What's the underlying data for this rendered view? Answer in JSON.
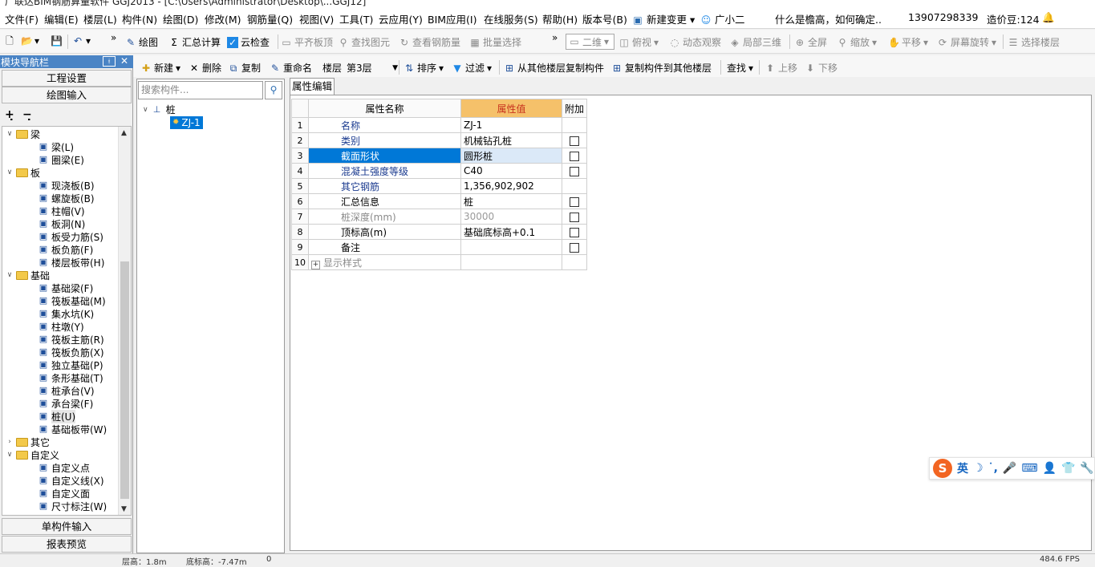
{
  "title_bar": "广联达BIM钢筋算量软件 GGJ2013 - [C:\\Users\\Administrator\\Desktop\\...GGJ12]",
  "menu": [
    "文件(F)",
    "编辑(E)",
    "楼层(L)",
    "构件(N)",
    "绘图(D)",
    "修改(M)",
    "钢筋量(Q)",
    "视图(V)",
    "工具(T)",
    "云应用(Y)",
    "BIM应用(I)",
    "在线服务(S)",
    "帮助(H)",
    "版本号(B)"
  ],
  "menu_extra": {
    "new_change": "新建变更",
    "assistant": "广小二",
    "question": "什么是檐高，如何确定..",
    "phone": "13907298339",
    "points": "造价豆:124"
  },
  "toolbar1": {
    "items": [
      "绘图",
      "汇总计算",
      "云检查",
      "平齐板顶",
      "查找图元",
      "查看钢筋量",
      "批量选择",
      "二维",
      "俯视",
      "动态观察",
      "局部三维",
      "全屏",
      "缩放",
      "平移",
      "屏幕旋转",
      "选择楼层"
    ],
    "more": "»"
  },
  "toolbar2": {
    "new": "新建",
    "delete": "删除",
    "copy": "复制",
    "rename": "重命名",
    "floor_label": "楼层",
    "floor_value": "第3层",
    "sort": "排序",
    "filter": "过滤",
    "copy_from": "从其他楼层复制构件",
    "copy_to": "复制构件到其他楼层",
    "find": "查找",
    "move_up": "上移",
    "move_down": "下移"
  },
  "nav": {
    "header": "模块导航栏",
    "project_settings": "工程设置",
    "drawing_input": "绘图输入",
    "single_input": "单构件输入",
    "report_preview": "报表预览",
    "tree": [
      {
        "type": "folder",
        "label": "梁",
        "level": 0,
        "open": true
      },
      {
        "type": "leaf",
        "label": "梁(L)",
        "icon": "beam-icon"
      },
      {
        "type": "leaf",
        "label": "圈梁(E)",
        "icon": "ring-beam-icon"
      },
      {
        "type": "folder",
        "label": "板",
        "level": 0,
        "open": true
      },
      {
        "type": "leaf",
        "label": "现浇板(B)",
        "icon": "slab-icon"
      },
      {
        "type": "leaf",
        "label": "螺旋板(B)",
        "icon": "spiral-slab-icon"
      },
      {
        "type": "leaf",
        "label": "柱帽(V)",
        "icon": "column-cap-icon"
      },
      {
        "type": "leaf",
        "label": "板洞(N)",
        "icon": "slab-hole-icon"
      },
      {
        "type": "leaf",
        "label": "板受力筋(S)",
        "icon": "slab-rebar-icon"
      },
      {
        "type": "leaf",
        "label": "板负筋(F)",
        "icon": "slab-neg-rebar-icon"
      },
      {
        "type": "leaf",
        "label": "楼层板带(H)",
        "icon": "slab-strip-icon"
      },
      {
        "type": "folder",
        "label": "基础",
        "level": 0,
        "open": true
      },
      {
        "type": "leaf",
        "label": "基础梁(F)",
        "icon": "foundation-beam-icon"
      },
      {
        "type": "leaf",
        "label": "筏板基础(M)",
        "icon": "raft-icon"
      },
      {
        "type": "leaf",
        "label": "集水坑(K)",
        "icon": "sump-icon"
      },
      {
        "type": "leaf",
        "label": "柱墩(Y)",
        "icon": "pier-icon"
      },
      {
        "type": "leaf",
        "label": "筏板主筋(R)",
        "icon": "raft-rebar-icon"
      },
      {
        "type": "leaf",
        "label": "筏板负筋(X)",
        "icon": "raft-neg-rebar-icon"
      },
      {
        "type": "leaf",
        "label": "独立基础(P)",
        "icon": "isolated-foundation-icon"
      },
      {
        "type": "leaf",
        "label": "条形基础(T)",
        "icon": "strip-foundation-icon"
      },
      {
        "type": "leaf",
        "label": "桩承台(V)",
        "icon": "pile-cap-icon"
      },
      {
        "type": "leaf",
        "label": "承台梁(F)",
        "icon": "cap-beam-icon"
      },
      {
        "type": "leaf",
        "label": "桩(U)",
        "icon": "pile-icon"
      },
      {
        "type": "leaf",
        "label": "基础板带(W)",
        "icon": "foundation-strip-icon"
      },
      {
        "type": "folder",
        "label": "其它",
        "level": 0,
        "open": false
      },
      {
        "type": "folder",
        "label": "自定义",
        "level": 0,
        "open": true
      },
      {
        "type": "leaf",
        "label": "自定义点",
        "icon": "custom-point-icon"
      },
      {
        "type": "leaf",
        "label": "自定义线(X)",
        "icon": "custom-line-icon"
      },
      {
        "type": "leaf",
        "label": "自定义面",
        "icon": "custom-area-icon"
      },
      {
        "type": "leaf",
        "label": "尺寸标注(W)",
        "icon": "dimension-icon"
      }
    ]
  },
  "components": {
    "search_placeholder": "搜索构件...",
    "root": "桩",
    "child": "ZJ-1"
  },
  "props": {
    "tab": "属性编辑",
    "headers": {
      "name": "属性名称",
      "value": "属性值",
      "extra": "附加"
    },
    "rows": [
      {
        "n": "1",
        "name": "名称",
        "value": "ZJ-1",
        "check": false,
        "style": "blue"
      },
      {
        "n": "2",
        "name": "类别",
        "value": "机械钻孔桩",
        "check": true,
        "style": "blue"
      },
      {
        "n": "3",
        "name": "截面形状",
        "value": "圆形桩",
        "check": true,
        "style": "blue"
      },
      {
        "n": "4",
        "name": "混凝土强度等级",
        "value": "C40",
        "check": true,
        "style": "blue"
      },
      {
        "n": "5",
        "name": "其它钢筋",
        "value": "1,356,902,902",
        "check": false,
        "style": "blue"
      },
      {
        "n": "6",
        "name": "汇总信息",
        "value": "桩",
        "check": true,
        "style": "black"
      },
      {
        "n": "7",
        "name": "桩深度(mm)",
        "value": "30000",
        "check": true,
        "style": "grey"
      },
      {
        "n": "8",
        "name": "顶标高(m)",
        "value": "基础底标高+0.1",
        "check": true,
        "style": "black"
      },
      {
        "n": "9",
        "name": "备注",
        "value": "",
        "check": true,
        "style": "black"
      },
      {
        "n": "10",
        "name": "显示样式",
        "value": "",
        "check": false,
        "style": "grey"
      }
    ],
    "selected_row": 3
  },
  "status": {
    "floor_height": "层高：1.8m",
    "bottom_elev": "底标高：-7.47m",
    "zero": "0",
    "fps": "484.6 FPS"
  }
}
